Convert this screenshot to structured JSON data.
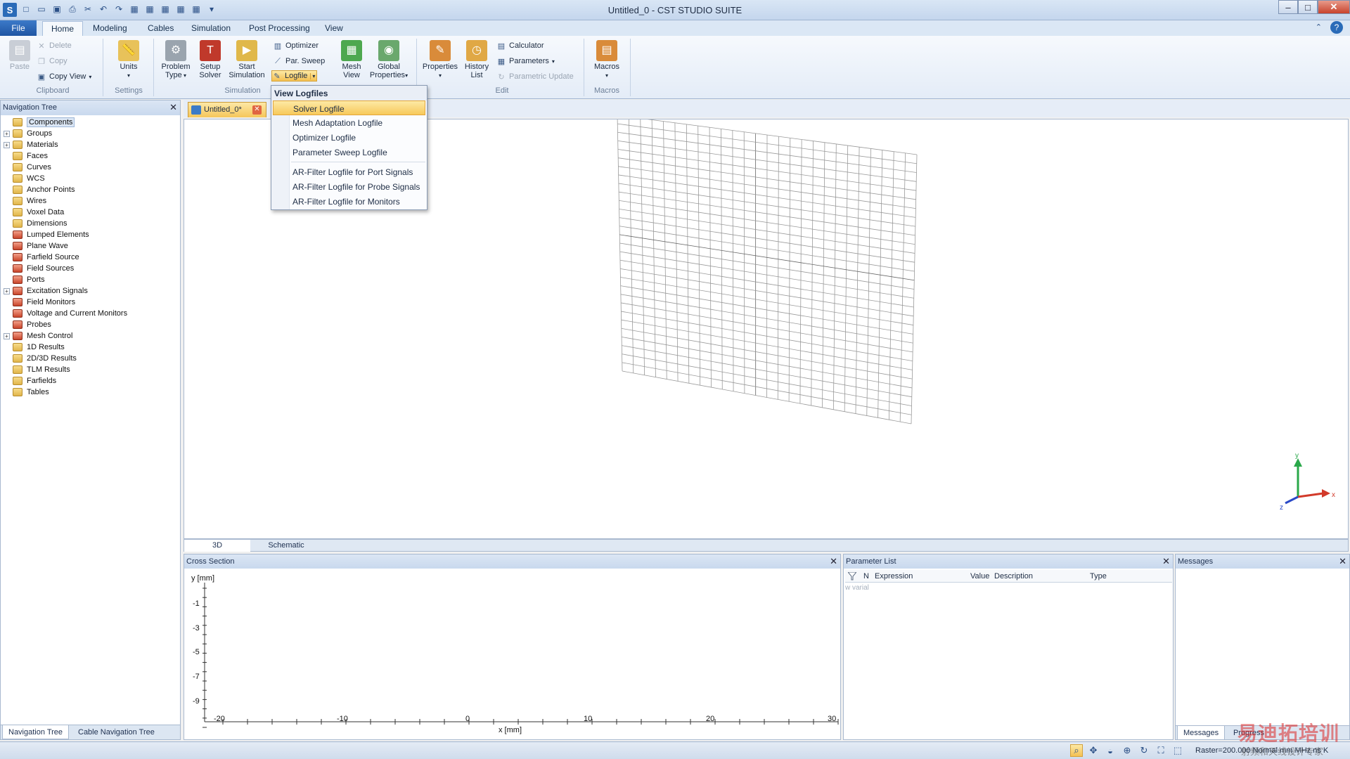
{
  "window": {
    "title": "Untitled_0 - CST STUDIO SUITE"
  },
  "ribbon_tabs": [
    "File",
    "Home",
    "Modeling",
    "Cables",
    "Simulation",
    "Post Processing",
    "View"
  ],
  "ribbon": {
    "clipboard": {
      "paste": "Paste",
      "delete": "Delete",
      "copy": "Copy",
      "copy_view": "Copy View",
      "label": "Clipboard"
    },
    "settings": {
      "units": "Units",
      "label": "Settings"
    },
    "simulation": {
      "problem_type": "Problem Type",
      "setup_solver": "Setup Solver",
      "start_simulation": "Start Simulation",
      "optimizer": "Optimizer",
      "par_sweep": "Par. Sweep",
      "logfile": "Logfile",
      "label": "Simulation"
    },
    "mesh": {
      "mesh_view": "Mesh View",
      "global_properties": "Global Properties"
    },
    "edit": {
      "properties": "Properties",
      "history_list": "History List",
      "calculator": "Calculator",
      "parameters": "Parameters",
      "parametric_update": "Parametric Update",
      "label": "Edit"
    },
    "macros": {
      "macros": "Macros",
      "label": "Macros"
    }
  },
  "logfile_menu": {
    "title": "View Logfiles",
    "items": [
      "Solver Logfile",
      "Mesh Adaptation Logfile",
      "Optimizer Logfile",
      "Parameter Sweep Logfile"
    ],
    "items2": [
      "AR-Filter Logfile for Port Signals",
      "AR-Filter Logfile for Probe Signals",
      "AR-Filter Logfile for Monitors"
    ]
  },
  "nav": {
    "title": "Navigation Tree",
    "items": [
      {
        "label": "Components",
        "expandable": false,
        "icon": "folder"
      },
      {
        "label": "Groups",
        "expandable": true,
        "icon": "folder"
      },
      {
        "label": "Materials",
        "expandable": true,
        "icon": "folder"
      },
      {
        "label": "Faces",
        "expandable": false,
        "icon": "folder"
      },
      {
        "label": "Curves",
        "expandable": false,
        "icon": "folder"
      },
      {
        "label": "WCS",
        "expandable": false,
        "icon": "folder"
      },
      {
        "label": "Anchor Points",
        "expandable": false,
        "icon": "folder"
      },
      {
        "label": "Wires",
        "expandable": false,
        "icon": "folder"
      },
      {
        "label": "Voxel Data",
        "expandable": false,
        "icon": "folder"
      },
      {
        "label": "Dimensions",
        "expandable": false,
        "icon": "folder"
      },
      {
        "label": "Lumped Elements",
        "expandable": false,
        "icon": "redfolder"
      },
      {
        "label": "Plane Wave",
        "expandable": false,
        "icon": "redfolder"
      },
      {
        "label": "Farfield Source",
        "expandable": false,
        "icon": "redfolder"
      },
      {
        "label": "Field Sources",
        "expandable": false,
        "icon": "redfolder"
      },
      {
        "label": "Ports",
        "expandable": false,
        "icon": "redfolder"
      },
      {
        "label": "Excitation Signals",
        "expandable": true,
        "icon": "redfolder"
      },
      {
        "label": "Field Monitors",
        "expandable": false,
        "icon": "redfolder"
      },
      {
        "label": "Voltage and Current Monitors",
        "expandable": false,
        "icon": "redfolder"
      },
      {
        "label": "Probes",
        "expandable": false,
        "icon": "redfolder"
      },
      {
        "label": "Mesh Control",
        "expandable": true,
        "icon": "redfolder"
      },
      {
        "label": "1D Results",
        "expandable": false,
        "icon": "folder"
      },
      {
        "label": "2D/3D Results",
        "expandable": false,
        "icon": "folder"
      },
      {
        "label": "TLM Results",
        "expandable": false,
        "icon": "folder"
      },
      {
        "label": "Farfields",
        "expandable": false,
        "icon": "folder"
      },
      {
        "label": "Tables",
        "expandable": false,
        "icon": "folder"
      }
    ],
    "tabs": [
      "Navigation Tree",
      "Cable Navigation Tree"
    ]
  },
  "document": {
    "tab": "Untitled_0*",
    "view_tabs": [
      "3D",
      "Schematic"
    ]
  },
  "axes": {
    "x": "x",
    "y": "y",
    "z": "z"
  },
  "cross_section": {
    "title": "Cross Section",
    "ylabel": "y [mm]",
    "xlabel": "x [mm]",
    "yticks": [
      "-1",
      "-3",
      "-5",
      "-7",
      "-9"
    ],
    "xticks": [
      "-20",
      "-10",
      "0",
      "10",
      "20",
      "30"
    ]
  },
  "parameter_list": {
    "title": "Parameter List",
    "columns": [
      "N",
      "Expression",
      "Value",
      "Description",
      "Type"
    ],
    "new_row_placeholder": "w varial"
  },
  "messages": {
    "title": "Messages",
    "tabs": [
      "Messages",
      "Progress"
    ]
  },
  "status": {
    "raster": "Raster=200.000  Normal  mm  MHz  ns  K"
  },
  "watermark": {
    "main": "易迪拓培训",
    "sub": "射频和天线设计专家"
  },
  "colors": {
    "ribbon_bg": "#e4ecf7",
    "highlight": "#f7c95a",
    "accent": "#2a6bb8"
  }
}
